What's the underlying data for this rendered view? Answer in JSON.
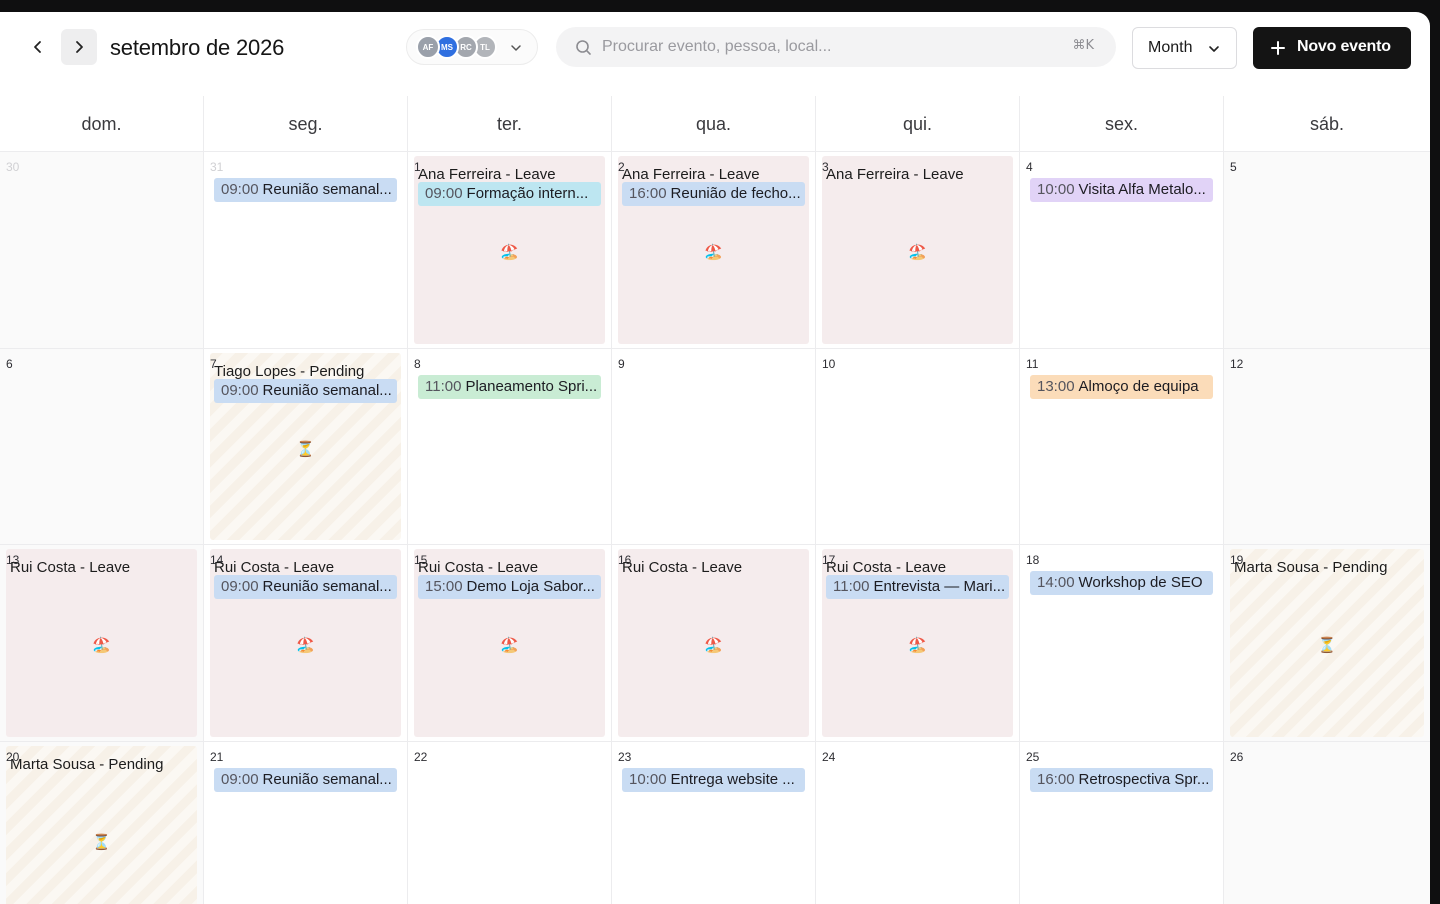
{
  "header": {
    "title": "setembro de 2026",
    "prev_label": "Mês anterior",
    "next_label": "Mês seguinte",
    "avatars": [
      {
        "initials": "AF",
        "color": "#9aa0aa"
      },
      {
        "initials": "MS",
        "color": "#2f6fe0"
      },
      {
        "initials": "RC",
        "color": "#a3a7ae"
      },
      {
        "initials": "TL",
        "color": "#b2b5ba"
      }
    ],
    "search_placeholder": "Procurar evento, pessoa, local...",
    "search_value": "",
    "shortcut": "⌘K",
    "view_label": "Month",
    "new_event_label": "Novo evento"
  },
  "weekdays": [
    "dom.",
    "seg.",
    "ter.",
    "qua.",
    "qui.",
    "sex.",
    "sáb."
  ],
  "weeks": [
    [
      {
        "num": "30",
        "out": true
      },
      {
        "num": "31",
        "out": true,
        "events": [
          {
            "time": "09:00",
            "title": "Reunião semanal...",
            "color": "blue"
          }
        ]
      },
      {
        "num": "1",
        "bg": {
          "type": "leave",
          "title": "Ana Ferreira - Leave",
          "icon": "🏖️"
        },
        "events": [
          {
            "time": "09:00",
            "title": "Formação intern...",
            "color": "cyan"
          }
        ]
      },
      {
        "num": "2",
        "bg": {
          "type": "leave",
          "title": "Ana Ferreira - Leave",
          "icon": "🏖️"
        },
        "events": [
          {
            "time": "16:00",
            "title": "Reunião de fecho...",
            "color": "blue"
          }
        ]
      },
      {
        "num": "3",
        "bg": {
          "type": "leave",
          "title": "Ana Ferreira - Leave",
          "icon": "🏖️"
        }
      },
      {
        "num": "4",
        "events": [
          {
            "time": "10:00",
            "title": "Visita Alfa Metalo...",
            "color": "purple"
          }
        ]
      },
      {
        "num": "5"
      }
    ],
    [
      {
        "num": "6"
      },
      {
        "num": "7",
        "bg": {
          "type": "pending",
          "title": "Tiago Lopes - Pending",
          "icon": "⏳"
        },
        "events": [
          {
            "time": "09:00",
            "title": "Reunião semanal...",
            "color": "blue"
          }
        ]
      },
      {
        "num": "8",
        "events": [
          {
            "time": "11:00",
            "title": "Planeamento Spri...",
            "color": "green"
          }
        ]
      },
      {
        "num": "9"
      },
      {
        "num": "10"
      },
      {
        "num": "11",
        "events": [
          {
            "time": "13:00",
            "title": "Almoço de equipa",
            "color": "orange"
          }
        ]
      },
      {
        "num": "12"
      }
    ],
    [
      {
        "num": "13",
        "bg": {
          "type": "leave",
          "title": "Rui Costa - Leave",
          "icon": "🏖️"
        }
      },
      {
        "num": "14",
        "bg": {
          "type": "leave",
          "title": "Rui Costa - Leave",
          "icon": "🏖️"
        },
        "events": [
          {
            "time": "09:00",
            "title": "Reunião semanal...",
            "color": "blue"
          }
        ]
      },
      {
        "num": "15",
        "bg": {
          "type": "leave",
          "title": "Rui Costa - Leave",
          "icon": "🏖️"
        },
        "events": [
          {
            "time": "15:00",
            "title": "Demo Loja Sabor...",
            "color": "blue"
          }
        ]
      },
      {
        "num": "16",
        "bg": {
          "type": "leave",
          "title": "Rui Costa - Leave",
          "icon": "🏖️"
        }
      },
      {
        "num": "17",
        "bg": {
          "type": "leave",
          "title": "Rui Costa - Leave",
          "icon": "🏖️"
        },
        "events": [
          {
            "time": "11:00",
            "title": "Entrevista — Mari...",
            "color": "blue"
          }
        ]
      },
      {
        "num": "18",
        "events": [
          {
            "time": "14:00",
            "title": "Workshop de SEO",
            "color": "blue"
          }
        ]
      },
      {
        "num": "19",
        "bg": {
          "type": "pending",
          "title": "Marta Sousa - Pending",
          "icon": "⏳"
        }
      }
    ],
    [
      {
        "num": "20",
        "bg": {
          "type": "pending",
          "title": "Marta Sousa - Pending",
          "icon": "⏳"
        }
      },
      {
        "num": "21",
        "events": [
          {
            "time": "09:00",
            "title": "Reunião semanal...",
            "color": "blue"
          }
        ]
      },
      {
        "num": "22"
      },
      {
        "num": "23",
        "events": [
          {
            "time": "10:00",
            "title": "Entrega website ...",
            "color": "blue"
          }
        ]
      },
      {
        "num": "24"
      },
      {
        "num": "25",
        "events": [
          {
            "time": "16:00",
            "title": "Retrospectiva Spr...",
            "color": "blue"
          }
        ]
      },
      {
        "num": "26"
      }
    ]
  ]
}
